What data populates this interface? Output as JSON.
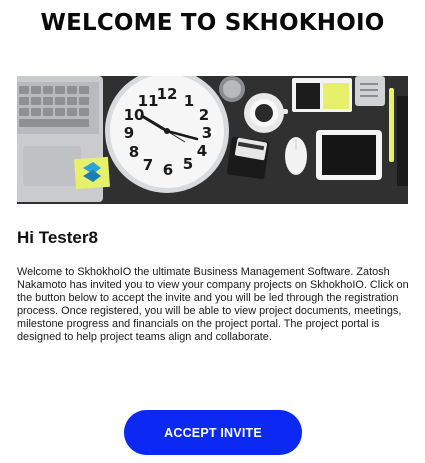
{
  "header": {
    "title": "WELCOME TO SKHOKHOIO"
  },
  "hero": {
    "clock_numbers": [
      "12",
      "1",
      "2",
      "3",
      "4",
      "5",
      "6",
      "7",
      "8",
      "9",
      "10",
      "11"
    ]
  },
  "content": {
    "greeting": "Hi Tester8",
    "message": "Welcome to SkhokhoIO the ultimate Business Management Software. Zatosh Nakamoto has invited you to view your company projects on SkhokhoIO. Click on the button below to accept the invite and you will be led through the registration process. Once registered, you will be able to view project documents, meetings, milestone progress and financials on the project portal. The project portal is designed to help project teams align and collaborate."
  },
  "actions": {
    "accept_label": "ACCEPT INVITE"
  },
  "colors": {
    "accent": "#0b29f2",
    "sticky_note": "#e6f06a"
  }
}
